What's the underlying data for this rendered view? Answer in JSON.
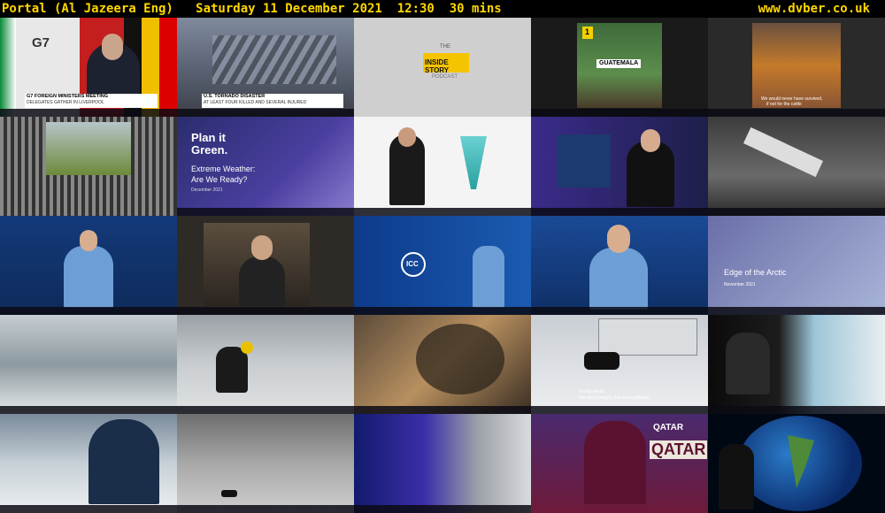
{
  "header": {
    "title": "Portal (Al Jazeera Eng)   Saturday 11 December 2021  12:30  30 mins",
    "site": "www.dvber.co.uk"
  },
  "tiles": [
    {
      "id": "r1c1",
      "caption1": "G7 FOREIGN MINISTERS MEETING",
      "caption2": "DELEGATES GATHER IN LIVERPOOL",
      "overlay": "G7"
    },
    {
      "id": "r1c2",
      "caption1": "U.S. TORNADO DISASTER",
      "caption2": "AT LEAST FOUR KILLED AND SEVERAL INJURED"
    },
    {
      "id": "r1c3",
      "caption1": "THE",
      "caption2": "INSIDE STORY",
      "caption3": "PODCAST"
    },
    {
      "id": "r1c4",
      "caption1": "GUATEMALA",
      "badge": "1"
    },
    {
      "id": "r1c5",
      "caption1": "We would never have survived,",
      "caption2": "if not for the cattle"
    },
    {
      "id": "r2c1"
    },
    {
      "id": "r2c2",
      "caption1": "Plan it",
      "caption2": "Green.",
      "caption3": "Extreme Weather:",
      "caption4": "Are We Ready?",
      "caption5": "December 2021"
    },
    {
      "id": "r2c3"
    },
    {
      "id": "r2c4"
    },
    {
      "id": "r2c5"
    },
    {
      "id": "r3c1"
    },
    {
      "id": "r3c2"
    },
    {
      "id": "r3c3",
      "caption1": "ICC"
    },
    {
      "id": "r3c4"
    },
    {
      "id": "r3c5",
      "caption1": "Edge of the Arctic",
      "caption2": "November 2021"
    },
    {
      "id": "r4c1"
    },
    {
      "id": "r4c2"
    },
    {
      "id": "r4c3"
    },
    {
      "id": "r4c4",
      "caption1": "In this world,",
      "caption2": "the more people, the more pollution."
    },
    {
      "id": "r4c5"
    },
    {
      "id": "r5c1"
    },
    {
      "id": "r5c2"
    },
    {
      "id": "r5c3"
    },
    {
      "id": "r5c4",
      "caption1": "QATAR",
      "caption2": "QATAR"
    },
    {
      "id": "r5c5"
    }
  ],
  "colors": {
    "header_text": "#ffd700",
    "background": "#000000",
    "aj_gold": "#d4a017"
  }
}
